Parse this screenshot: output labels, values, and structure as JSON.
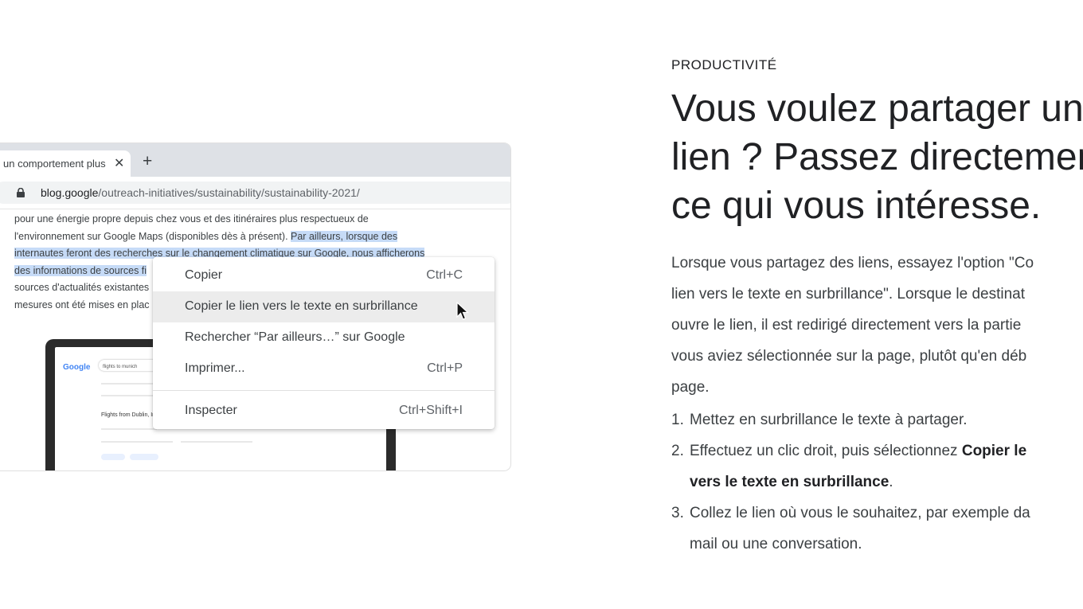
{
  "illustration": {
    "tab_title": "un comportement plus",
    "tab_close": "✕",
    "new_tab": "+",
    "url_host": "blog.google",
    "url_path": "/outreach-initiatives/sustainability/sustainability-2021/",
    "page_lines": [
      "pour une énergie propre depuis chez vous et des itinéraires plus respectueux de",
      "l'environnement sur Google Maps (disponibles dès à présent). ",
      "Par ailleurs, lorsque des",
      "internautes feront des recherches sur le changement climatique sur Google, nous afficherons",
      "des informations de sources fi",
      "sources d'actualités existantes",
      "mesures ont été mises en plac"
    ],
    "laptop_google_logo": "Google",
    "laptop_query": "flights to munich",
    "laptop_heading": "Flights from Dublin, Irel",
    "context_menu": [
      {
        "label": "Copier",
        "shortcut": "Ctrl+C"
      },
      {
        "label": "Copier le lien vers le texte en surbrillance",
        "shortcut": ""
      },
      {
        "label": "Rechercher “Par ailleurs…” sur Google",
        "shortcut": ""
      },
      {
        "label": "Imprimer...",
        "shortcut": "Ctrl+P"
      },
      {
        "label": "Inspecter",
        "shortcut": "Ctrl+Shift+I"
      }
    ],
    "highlight_color": "#c6dbf7"
  },
  "article": {
    "eyebrow": "PRODUCTIVITÉ",
    "headline_lines": [
      "Vous voulez partager un",
      "lien ? Passez directemen",
      "ce qui vous intéresse."
    ],
    "body_lines": [
      "Lorsque vous partagez des liens, essayez l'option \"Co",
      "lien vers le texte en surbrillance\". Lorsque le destinat",
      "ouvre le lien, il est redirigé directement vers la partie",
      "vous aviez sélectionnée sur la page, plutôt qu'en déb",
      "page."
    ],
    "steps": [
      {
        "num": "1.",
        "text": "Mettez en surbrillance le texte à partager."
      },
      {
        "num": "2.",
        "text_before": "Effectuez un clic droit, puis sélectionnez ",
        "bold_1": "Copier le",
        "bold_2": "vers le texte en surbrillance",
        "text_after": "."
      },
      {
        "num": "3.",
        "line_1": "Collez le lien où vous le souhaitez, par exemple da",
        "line_2": "mail ou une conversation."
      }
    ]
  }
}
